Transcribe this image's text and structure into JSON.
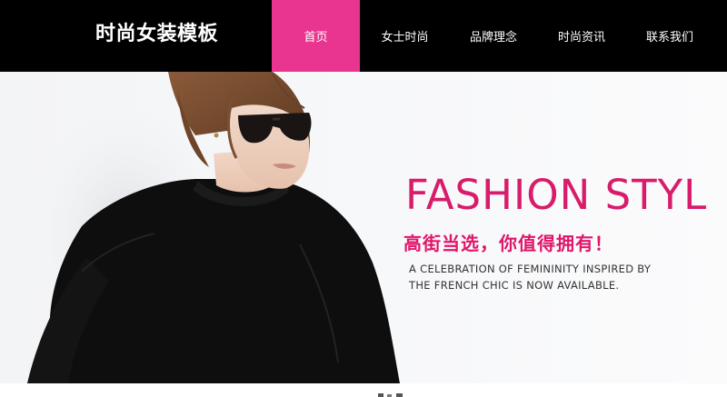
{
  "brand": {
    "logo_text": "时尚女装模板"
  },
  "nav": {
    "items": [
      {
        "label": "首页",
        "active": true
      },
      {
        "label": "女士时尚",
        "active": false
      },
      {
        "label": "品牌理念",
        "active": false
      },
      {
        "label": "时尚资讯",
        "active": false
      },
      {
        "label": "联系我们",
        "active": false
      }
    ]
  },
  "hero": {
    "title": "FASHION STYL",
    "subtitle": "高街当选，你值得拥有！",
    "desc_line1": "A CELEBRATION OF FEMININITY INSPIRED BY",
    "desc_line2": "THE FRENCH CHIC IS NOW AVAILABLE."
  },
  "colors": {
    "accent": "#e9358f",
    "title": "#d81c6b",
    "header_bg": "#000000"
  }
}
